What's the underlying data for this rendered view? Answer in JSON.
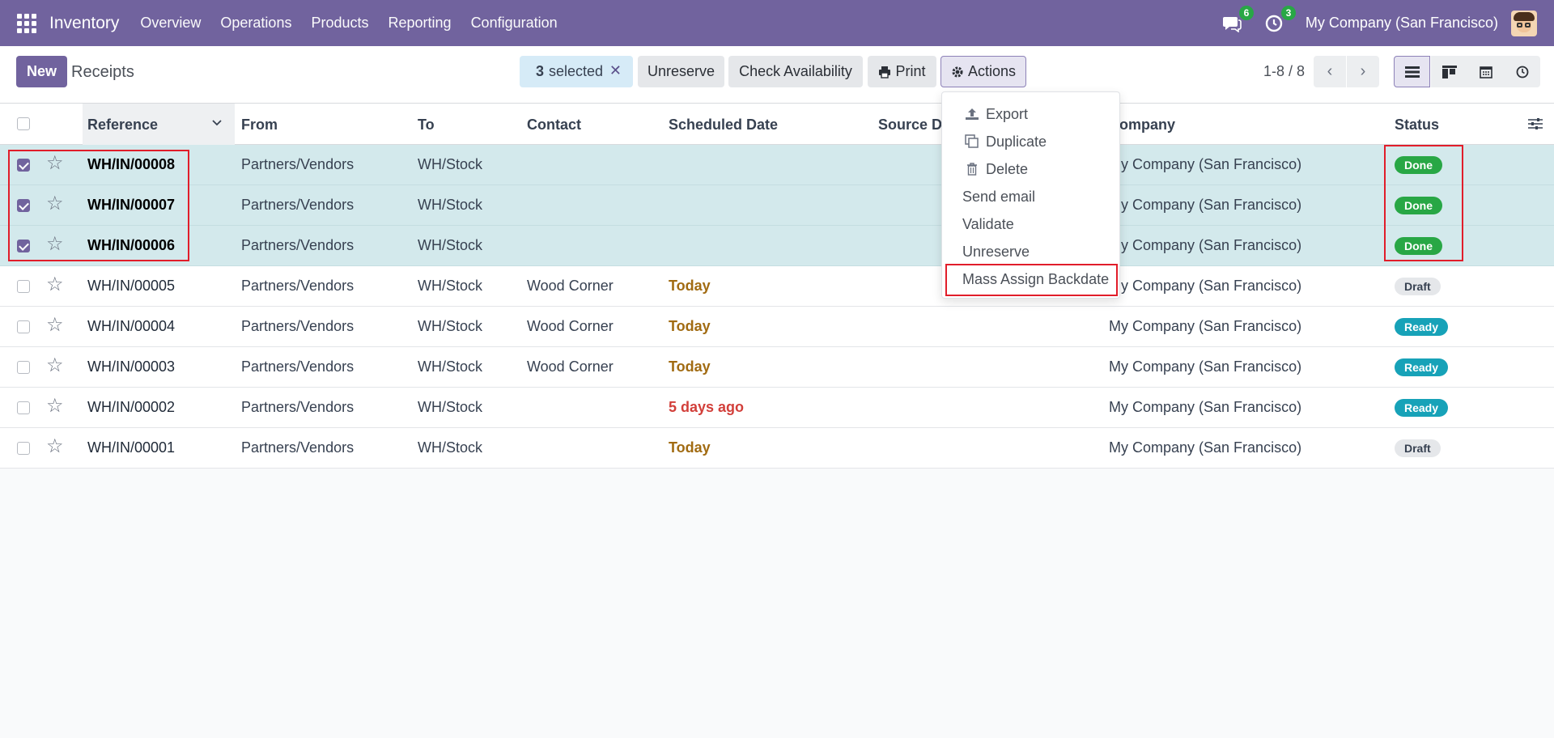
{
  "navbar": {
    "app_name": "Inventory",
    "menu": [
      "Overview",
      "Operations",
      "Products",
      "Reporting",
      "Configuration"
    ],
    "messages_count": "6",
    "activities_count": "3",
    "company": "My Company (San Francisco)"
  },
  "control_panel": {
    "new_label": "New",
    "breadcrumb": "Receipts",
    "selected_count": "3",
    "selected_label": "selected",
    "buttons": {
      "unreserve": "Unreserve",
      "check_availability": "Check Availability",
      "print": "Print",
      "actions": "Actions"
    },
    "pager": "1-8 / 8"
  },
  "table": {
    "headers": {
      "reference": "Reference",
      "from": "From",
      "to": "To",
      "contact": "Contact",
      "scheduled_date": "Scheduled Date",
      "source_document": "Source Do",
      "company": "Company",
      "status": "Status"
    },
    "rows": [
      {
        "ref": "WH/IN/00008",
        "from": "Partners/Vendors",
        "to": "WH/Stock",
        "contact": "",
        "date": "",
        "company": "My Company (San Francisco)",
        "status": "Done"
      },
      {
        "ref": "WH/IN/00007",
        "from": "Partners/Vendors",
        "to": "WH/Stock",
        "contact": "",
        "date": "",
        "company": "My Company (San Francisco)",
        "status": "Done"
      },
      {
        "ref": "WH/IN/00006",
        "from": "Partners/Vendors",
        "to": "WH/Stock",
        "contact": "",
        "date": "",
        "company": "My Company (San Francisco)",
        "status": "Done"
      },
      {
        "ref": "WH/IN/00005",
        "from": "Partners/Vendors",
        "to": "WH/Stock",
        "contact": "Wood Corner",
        "date": "Today",
        "company": "My Company (San Francisco)",
        "status": "Draft"
      },
      {
        "ref": "WH/IN/00004",
        "from": "Partners/Vendors",
        "to": "WH/Stock",
        "contact": "Wood Corner",
        "date": "Today",
        "company": "My Company (San Francisco)",
        "status": "Ready"
      },
      {
        "ref": "WH/IN/00003",
        "from": "Partners/Vendors",
        "to": "WH/Stock",
        "contact": "Wood Corner",
        "date": "Today",
        "company": "My Company (San Francisco)",
        "status": "Ready"
      },
      {
        "ref": "WH/IN/00002",
        "from": "Partners/Vendors",
        "to": "WH/Stock",
        "contact": "",
        "date": "5 days ago",
        "company": "My Company (San Francisco)",
        "status": "Ready"
      },
      {
        "ref": "WH/IN/00001",
        "from": "Partners/Vendors",
        "to": "WH/Stock",
        "contact": "",
        "date": "Today",
        "company": "My Company (San Francisco)",
        "status": "Draft"
      }
    ]
  },
  "actions_menu": {
    "items": [
      "Export",
      "Duplicate",
      "Delete",
      "Send email",
      "Validate",
      "Unreserve",
      "Mass Assign Backdate"
    ]
  },
  "colors": {
    "brand": "#71639e",
    "done": "#28a745",
    "ready": "#17a2b8",
    "annotation": "#e11d2a"
  }
}
